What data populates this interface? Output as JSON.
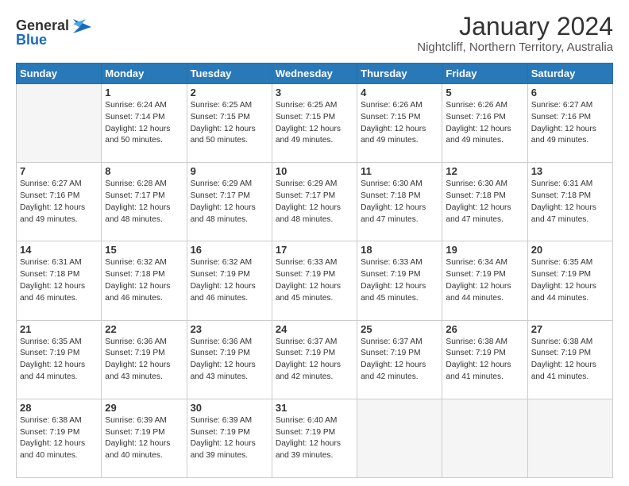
{
  "header": {
    "logo_general": "General",
    "logo_blue": "Blue",
    "title": "January 2024",
    "subtitle": "Nightcliff, Northern Territory, Australia"
  },
  "days_of_week": [
    "Sunday",
    "Monday",
    "Tuesday",
    "Wednesday",
    "Thursday",
    "Friday",
    "Saturday"
  ],
  "weeks": [
    [
      {
        "day": "",
        "sunrise": "",
        "sunset": "",
        "daylight": ""
      },
      {
        "day": "1",
        "sunrise": "6:24 AM",
        "sunset": "7:14 PM",
        "daylight": "12 hours and 50 minutes."
      },
      {
        "day": "2",
        "sunrise": "6:25 AM",
        "sunset": "7:15 PM",
        "daylight": "12 hours and 50 minutes."
      },
      {
        "day": "3",
        "sunrise": "6:25 AM",
        "sunset": "7:15 PM",
        "daylight": "12 hours and 49 minutes."
      },
      {
        "day": "4",
        "sunrise": "6:26 AM",
        "sunset": "7:15 PM",
        "daylight": "12 hours and 49 minutes."
      },
      {
        "day": "5",
        "sunrise": "6:26 AM",
        "sunset": "7:16 PM",
        "daylight": "12 hours and 49 minutes."
      },
      {
        "day": "6",
        "sunrise": "6:27 AM",
        "sunset": "7:16 PM",
        "daylight": "12 hours and 49 minutes."
      }
    ],
    [
      {
        "day": "7",
        "sunrise": "6:27 AM",
        "sunset": "7:16 PM",
        "daylight": "12 hours and 49 minutes."
      },
      {
        "day": "8",
        "sunrise": "6:28 AM",
        "sunset": "7:17 PM",
        "daylight": "12 hours and 48 minutes."
      },
      {
        "day": "9",
        "sunrise": "6:29 AM",
        "sunset": "7:17 PM",
        "daylight": "12 hours and 48 minutes."
      },
      {
        "day": "10",
        "sunrise": "6:29 AM",
        "sunset": "7:17 PM",
        "daylight": "12 hours and 48 minutes."
      },
      {
        "day": "11",
        "sunrise": "6:30 AM",
        "sunset": "7:18 PM",
        "daylight": "12 hours and 47 minutes."
      },
      {
        "day": "12",
        "sunrise": "6:30 AM",
        "sunset": "7:18 PM",
        "daylight": "12 hours and 47 minutes."
      },
      {
        "day": "13",
        "sunrise": "6:31 AM",
        "sunset": "7:18 PM",
        "daylight": "12 hours and 47 minutes."
      }
    ],
    [
      {
        "day": "14",
        "sunrise": "6:31 AM",
        "sunset": "7:18 PM",
        "daylight": "12 hours and 46 minutes."
      },
      {
        "day": "15",
        "sunrise": "6:32 AM",
        "sunset": "7:18 PM",
        "daylight": "12 hours and 46 minutes."
      },
      {
        "day": "16",
        "sunrise": "6:32 AM",
        "sunset": "7:19 PM",
        "daylight": "12 hours and 46 minutes."
      },
      {
        "day": "17",
        "sunrise": "6:33 AM",
        "sunset": "7:19 PM",
        "daylight": "12 hours and 45 minutes."
      },
      {
        "day": "18",
        "sunrise": "6:33 AM",
        "sunset": "7:19 PM",
        "daylight": "12 hours and 45 minutes."
      },
      {
        "day": "19",
        "sunrise": "6:34 AM",
        "sunset": "7:19 PM",
        "daylight": "12 hours and 44 minutes."
      },
      {
        "day": "20",
        "sunrise": "6:35 AM",
        "sunset": "7:19 PM",
        "daylight": "12 hours and 44 minutes."
      }
    ],
    [
      {
        "day": "21",
        "sunrise": "6:35 AM",
        "sunset": "7:19 PM",
        "daylight": "12 hours and 44 minutes."
      },
      {
        "day": "22",
        "sunrise": "6:36 AM",
        "sunset": "7:19 PM",
        "daylight": "12 hours and 43 minutes."
      },
      {
        "day": "23",
        "sunrise": "6:36 AM",
        "sunset": "7:19 PM",
        "daylight": "12 hours and 43 minutes."
      },
      {
        "day": "24",
        "sunrise": "6:37 AM",
        "sunset": "7:19 PM",
        "daylight": "12 hours and 42 minutes."
      },
      {
        "day": "25",
        "sunrise": "6:37 AM",
        "sunset": "7:19 PM",
        "daylight": "12 hours and 42 minutes."
      },
      {
        "day": "26",
        "sunrise": "6:38 AM",
        "sunset": "7:19 PM",
        "daylight": "12 hours and 41 minutes."
      },
      {
        "day": "27",
        "sunrise": "6:38 AM",
        "sunset": "7:19 PM",
        "daylight": "12 hours and 41 minutes."
      }
    ],
    [
      {
        "day": "28",
        "sunrise": "6:38 AM",
        "sunset": "7:19 PM",
        "daylight": "12 hours and 40 minutes."
      },
      {
        "day": "29",
        "sunrise": "6:39 AM",
        "sunset": "7:19 PM",
        "daylight": "12 hours and 40 minutes."
      },
      {
        "day": "30",
        "sunrise": "6:39 AM",
        "sunset": "7:19 PM",
        "daylight": "12 hours and 39 minutes."
      },
      {
        "day": "31",
        "sunrise": "6:40 AM",
        "sunset": "7:19 PM",
        "daylight": "12 hours and 39 minutes."
      },
      {
        "day": "",
        "sunrise": "",
        "sunset": "",
        "daylight": ""
      },
      {
        "day": "",
        "sunrise": "",
        "sunset": "",
        "daylight": ""
      },
      {
        "day": "",
        "sunrise": "",
        "sunset": "",
        "daylight": ""
      }
    ]
  ],
  "labels": {
    "sunrise_prefix": "Sunrise: ",
    "sunset_prefix": "Sunset: ",
    "daylight_prefix": "Daylight: "
  }
}
